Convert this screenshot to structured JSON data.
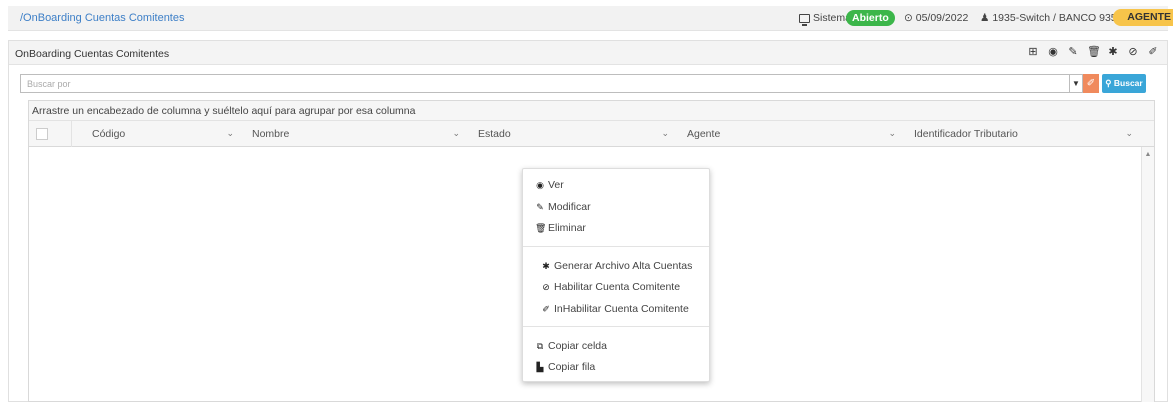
{
  "topbar": {
    "breadcrumb": "/OnBoarding Cuentas Comitentes",
    "system_label": "Sistema:",
    "system_status": "Abierto",
    "date": "05/09/2022",
    "user": "1935-Switch / BANCO 935",
    "role": "AGENTE",
    "colors": {
      "status": "#3cb64a",
      "role": "#f7c44a",
      "link": "#3d7fc7"
    }
  },
  "panel": {
    "title": "OnBoarding Cuentas Comitentes",
    "tools": [
      {
        "icon": "add-icon",
        "glyph": "⊞"
      },
      {
        "icon": "eye-icon",
        "glyph": "◉"
      },
      {
        "icon": "pencil-icon",
        "glyph": "✎"
      },
      {
        "icon": "trash-icon",
        "glyph": "🗑"
      },
      {
        "icon": "asterisk-icon",
        "glyph": "✱"
      },
      {
        "icon": "check-circle-icon",
        "glyph": "⊘"
      },
      {
        "icon": "eraser-icon",
        "glyph": "✐"
      }
    ]
  },
  "search": {
    "placeholder": "Buscar por",
    "button_label": "Buscar"
  },
  "grid": {
    "group_hint": "Arrastre un encabezado de columna y suéltelo aquí para agrupar por esa columna",
    "columns": [
      {
        "label": "Código"
      },
      {
        "label": "Nombre"
      },
      {
        "label": "Estado"
      },
      {
        "label": "Agente"
      },
      {
        "label": "Identificador Tributario"
      }
    ]
  },
  "context_menu": {
    "group1": [
      {
        "label": "Ver",
        "icon": "eye-icon"
      },
      {
        "label": "Modificar",
        "icon": "pencil-icon"
      },
      {
        "label": "Eliminar",
        "icon": "trash-icon"
      }
    ],
    "group2": [
      {
        "label": "Generar Archivo Alta Cuentas",
        "icon": "asterisk-icon"
      },
      {
        "label": "Habilitar Cuenta Comitente",
        "icon": "check-circle-icon"
      },
      {
        "label": "InHabilitar Cuenta Comitente",
        "icon": "eraser-icon"
      }
    ],
    "group3": [
      {
        "label": "Copiar celda",
        "icon": "copy-cell-icon"
      },
      {
        "label": "Copiar fila",
        "icon": "copy-row-icon"
      }
    ]
  }
}
